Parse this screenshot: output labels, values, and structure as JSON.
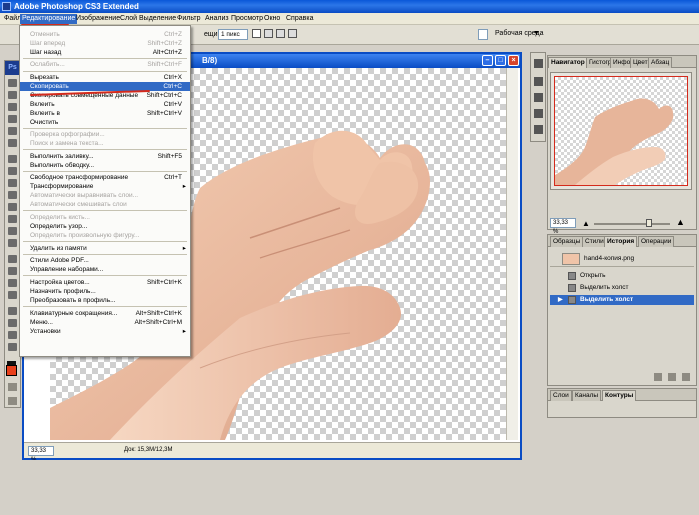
{
  "app": {
    "title": "Adobe Photoshop CS3 Extended"
  },
  "menubar": {
    "items": [
      "Файл",
      "Редактирование",
      "Изображение",
      "Слой",
      "Выделение",
      "Фильтр",
      "Анализ",
      "Просмотр",
      "Окно",
      "Справка"
    ]
  },
  "options": {
    "shading_label": "ещины:",
    "shading_value": "1 пикс",
    "workspace": "Рабочая среда"
  },
  "tools": {
    "ps_label": "Ps"
  },
  "document": {
    "title_fragment": "B/8)",
    "zoom": "33,33 %",
    "info": "Док: 15,3M/12,3M"
  },
  "edit_menu": {
    "items": [
      {
        "label": "Отменить",
        "shortcut": "Ctrl+Z",
        "disabled": true
      },
      {
        "label": "Шаг вперед",
        "shortcut": "Shift+Ctrl+Z",
        "disabled": true
      },
      {
        "label": "Шаг назад",
        "shortcut": "Alt+Ctrl+Z",
        "disabled": false
      },
      {
        "label": "Ослабить...",
        "shortcut": "Shift+Ctrl+F",
        "disabled": true
      },
      {
        "label": "Вырезать",
        "shortcut": "Ctrl+X",
        "disabled": false
      },
      {
        "label": "Скопировать",
        "shortcut": "Ctrl+C",
        "disabled": false,
        "selected": true
      },
      {
        "label": "Скопировать совмещенные данные",
        "shortcut": "Shift+Ctrl+C",
        "disabled": false
      },
      {
        "label": "Вклеить",
        "shortcut": "Ctrl+V",
        "disabled": false
      },
      {
        "label": "Вклеить в",
        "shortcut": "Shift+Ctrl+V",
        "disabled": false
      },
      {
        "label": "Очистить",
        "shortcut": "",
        "disabled": false
      },
      {
        "label": "Проверка орфографии...",
        "shortcut": "",
        "disabled": true
      },
      {
        "label": "Поиск и замена текста...",
        "shortcut": "",
        "disabled": true
      },
      {
        "label": "Выполнить заливку...",
        "shortcut": "Shift+F5",
        "disabled": false
      },
      {
        "label": "Выполнить обводку...",
        "shortcut": "",
        "disabled": false
      },
      {
        "label": "Свободное трансформирование",
        "shortcut": "Ctrl+T",
        "disabled": false
      },
      {
        "label": "Трансформирование",
        "shortcut": "",
        "disabled": false,
        "submenu": true
      },
      {
        "label": "Автоматически выравнивать слои...",
        "shortcut": "",
        "disabled": true
      },
      {
        "label": "Автоматически смешивать слои",
        "shortcut": "",
        "disabled": true
      },
      {
        "label": "Определить кисть...",
        "shortcut": "",
        "disabled": true
      },
      {
        "label": "Определить узор...",
        "shortcut": "",
        "disabled": false
      },
      {
        "label": "Определить произвольную фигуру...",
        "shortcut": "",
        "disabled": true
      },
      {
        "label": "Удалить из памяти",
        "shortcut": "",
        "disabled": false,
        "submenu": true
      },
      {
        "label": "Стили Adobe PDF...",
        "shortcut": "",
        "disabled": false
      },
      {
        "label": "Управление наборами...",
        "shortcut": "",
        "disabled": false
      },
      {
        "label": "Настройка цветов...",
        "shortcut": "Shift+Ctrl+K",
        "disabled": false
      },
      {
        "label": "Назначить профиль...",
        "shortcut": "",
        "disabled": false
      },
      {
        "label": "Преобразовать в профиль...",
        "shortcut": "",
        "disabled": false
      },
      {
        "label": "Клавиатурные сокращения...",
        "shortcut": "Alt+Shift+Ctrl+K",
        "disabled": false
      },
      {
        "label": "Меню...",
        "shortcut": "Alt+Shift+Ctrl+M",
        "disabled": false
      },
      {
        "label": "Установки",
        "shortcut": "",
        "disabled": false,
        "submenu": true
      }
    ]
  },
  "navigator": {
    "tabs": [
      "Навигатор",
      "Гистограмма",
      "Инфо",
      "Цвет",
      "Абзац"
    ],
    "zoom": "33,33 %"
  },
  "history": {
    "tabs": [
      "Образцы",
      "Стили",
      "История",
      "Операции"
    ],
    "snapshot": "hand4-копия.png",
    "steps": [
      {
        "label": "Открыть",
        "selected": false
      },
      {
        "label": "Выделить холст",
        "selected": false
      },
      {
        "label": "Выделить холст",
        "selected": true
      }
    ]
  },
  "layers": {
    "tabs": [
      "Слои",
      "Каналы",
      "Контуры"
    ]
  },
  "colors": {
    "accent": "#316ac5",
    "titlebar": "#0a4cc4",
    "redline": "#d42a1c"
  }
}
